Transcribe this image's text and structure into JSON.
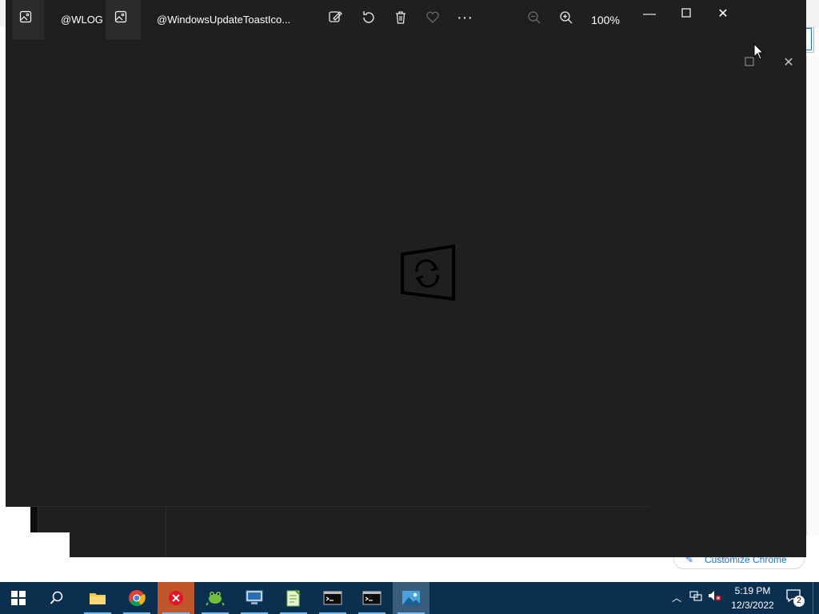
{
  "photos_app": {
    "tabs": [
      {
        "label": "@WLOGO"
      },
      {
        "label": "@WindowsUpdateToastIco..."
      }
    ],
    "zoom_level": "100%"
  },
  "background": {
    "customize_label": "Customize Chrome"
  },
  "taskbar": {
    "time": "5:19 PM",
    "date": "12/3/2022",
    "notification_count": "2",
    "apps": [
      {
        "name": "file-explorer"
      },
      {
        "name": "chrome"
      },
      {
        "name": "red-x-app"
      },
      {
        "name": "frog-app"
      },
      {
        "name": "network-app"
      },
      {
        "name": "notepad-plus-plus"
      },
      {
        "name": "terminal-1"
      },
      {
        "name": "terminal-2"
      },
      {
        "name": "photos"
      }
    ]
  }
}
